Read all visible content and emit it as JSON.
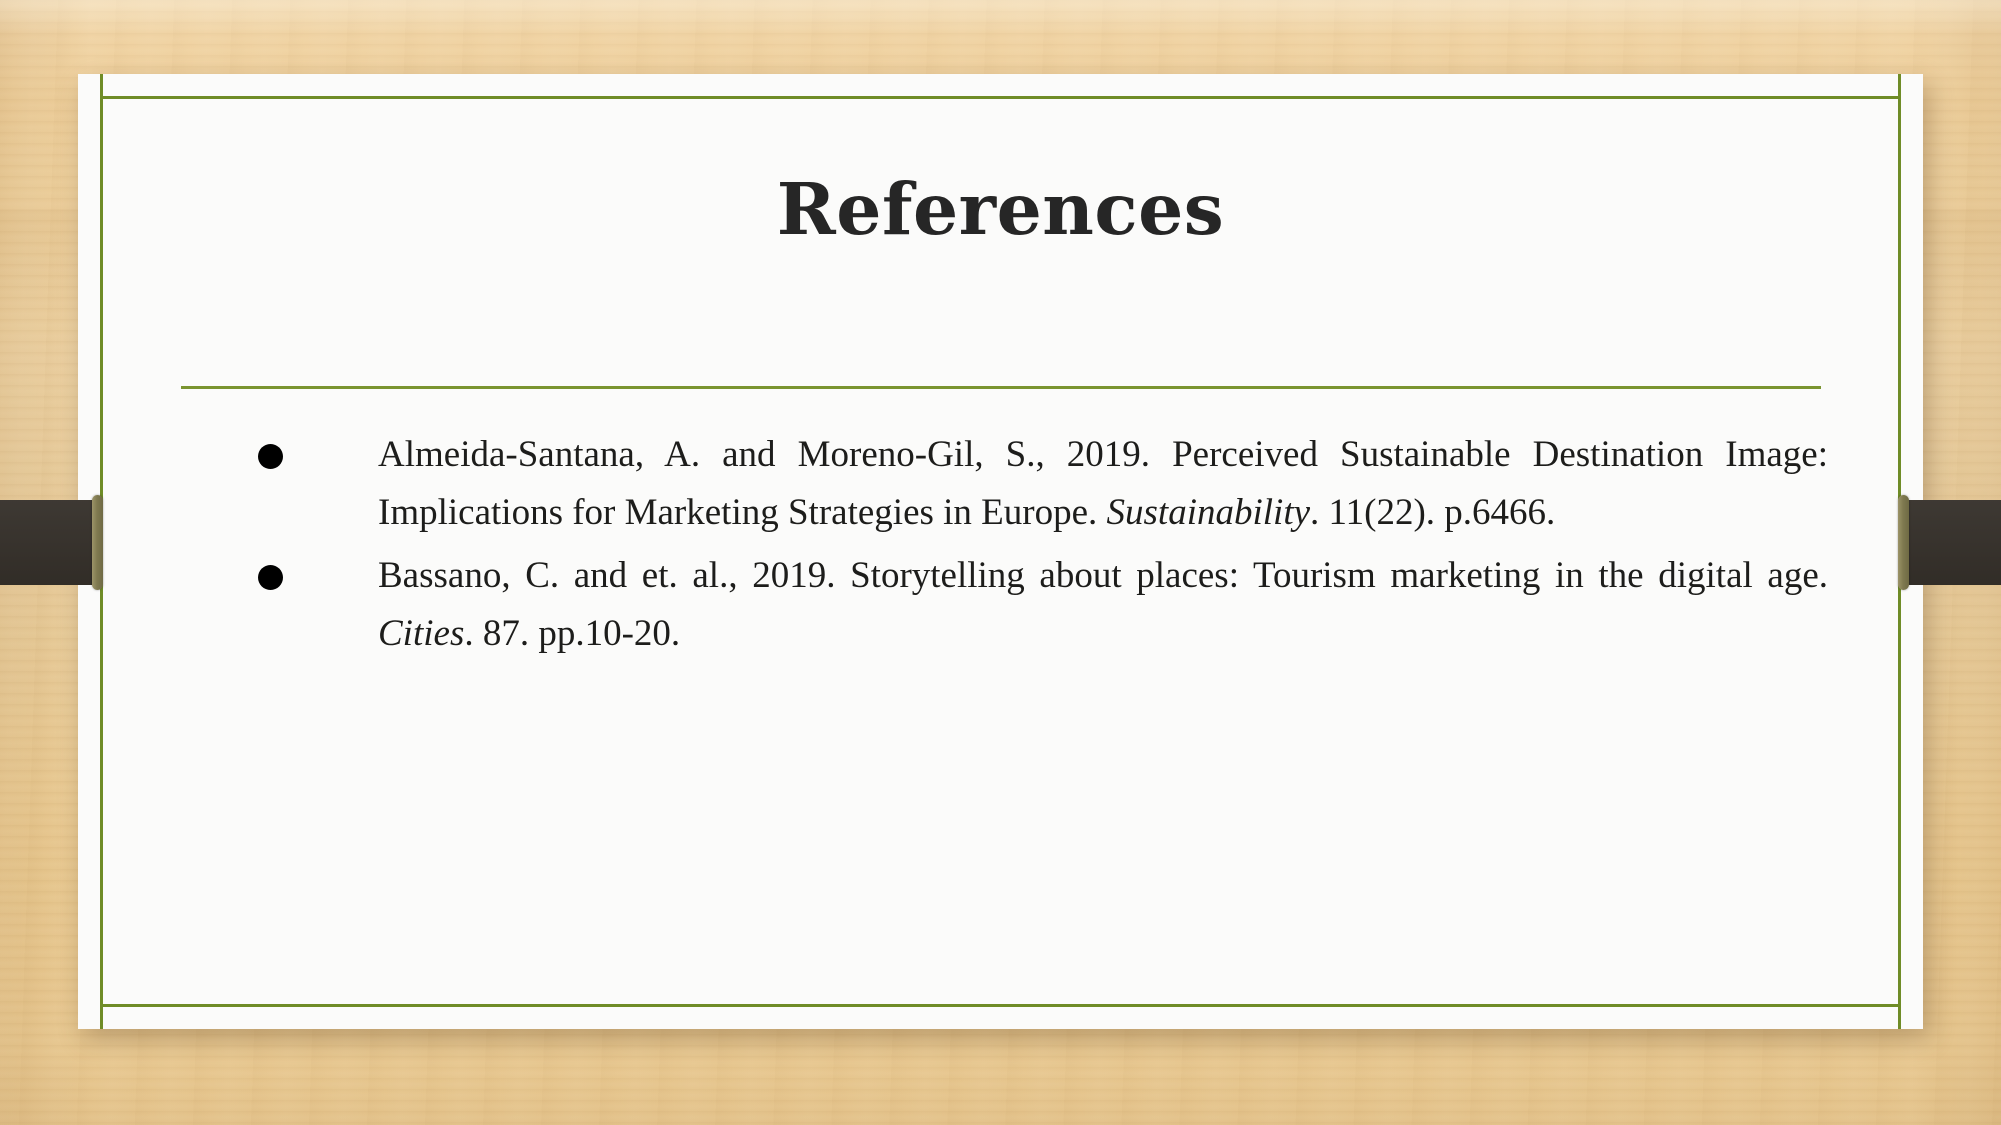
{
  "slide": {
    "title": "References",
    "theme": {
      "background_color": "#eecf9a",
      "card_color": "#fbfbfa",
      "accent_green": "#6f8c27",
      "divider_green": "#7a9430",
      "ribbon_color": "#35302a",
      "ribbon_cap_color": "#7f7a50",
      "title_color": "#262626",
      "body_text_color": "#1d1d1b",
      "bullet_color": "#000000"
    },
    "divider_label": "title-divider-line",
    "references": [
      {
        "bullet": "•",
        "parts": [
          {
            "text": "Almeida-Santana, A. and Moreno-Gil, S., 2019. Perceived Sustainable Destination Image: Implications for Marketing Strategies in Europe. ",
            "style": "normal"
          },
          {
            "text": "Sustainability",
            "style": "italic"
          },
          {
            "text": ". 11(22). p.6466.",
            "style": "normal"
          }
        ],
        "plain": "Almeida-Santana, A. and Moreno-Gil, S., 2019. Perceived Sustainable Destination Image: Implications for Marketing Strategies in Europe. Sustainability. 11(22). p.6466."
      },
      {
        "bullet": "•",
        "parts": [
          {
            "text": "Bassano, C. and et. al., 2019. Storytelling about places: Tourism marketing in the digital age. ",
            "style": "normal"
          },
          {
            "text": "Cities",
            "style": "italic"
          },
          {
            "text": ". 87. pp.10-20.",
            "style": "normal"
          }
        ],
        "plain": "Bassano, C. and et. al., 2019. Storytelling about places: Tourism marketing in the digital age. Cities. 87. pp.10-20."
      }
    ]
  }
}
